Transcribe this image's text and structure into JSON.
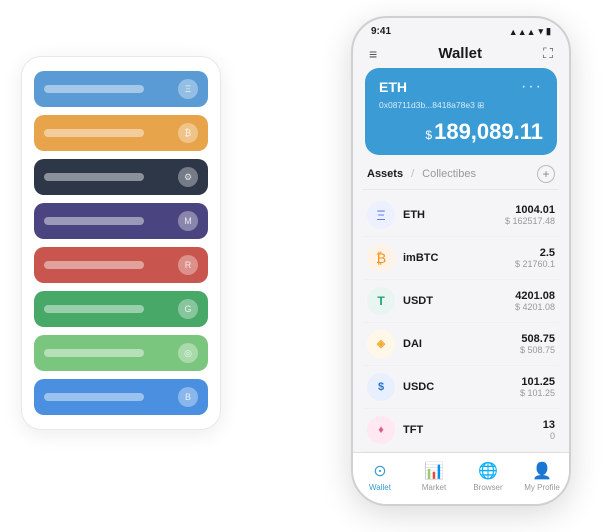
{
  "statusBar": {
    "time": "9:41",
    "signal": "●●●",
    "wifi": "▲",
    "battery": "■"
  },
  "header": {
    "menuIcon": "≡",
    "title": "Wallet",
    "expandIcon": "⛶"
  },
  "ethCard": {
    "title": "ETH",
    "dotsMenu": "···",
    "address": "0x08711d3b...8418a78e3 ⊞",
    "currencySymbol": "$",
    "amount": "189,089.11"
  },
  "assets": {
    "tabActive": "Assets",
    "separator": "/",
    "tabInactive": "Collectibes",
    "addIcon": "+"
  },
  "assetList": [
    {
      "id": "eth",
      "icon": "Ξ",
      "name": "ETH",
      "amount": "1004.01",
      "usd": "$ 162517.48",
      "iconClass": "icon-eth"
    },
    {
      "id": "imbtc",
      "icon": "₿",
      "name": "imBTC",
      "amount": "2.5",
      "usd": "$ 21760.1",
      "iconClass": "icon-btc"
    },
    {
      "id": "usdt",
      "icon": "T",
      "name": "USDT",
      "amount": "4201.08",
      "usd": "$ 4201.08",
      "iconClass": "icon-usdt"
    },
    {
      "id": "dai",
      "icon": "◈",
      "name": "DAI",
      "amount": "508.75",
      "usd": "$ 508.75",
      "iconClass": "icon-dai"
    },
    {
      "id": "usdc",
      "icon": "$",
      "name": "USDC",
      "amount": "101.25",
      "usd": "$ 101.25",
      "iconClass": "icon-usdc"
    },
    {
      "id": "tft",
      "icon": "♦",
      "name": "TFT",
      "amount": "13",
      "usd": "0",
      "iconClass": "icon-tft"
    }
  ],
  "bottomNav": [
    {
      "id": "wallet",
      "icon": "⊙",
      "label": "Wallet",
      "active": true
    },
    {
      "id": "market",
      "icon": "📈",
      "label": "Market",
      "active": false
    },
    {
      "id": "browser",
      "icon": "🌐",
      "label": "Browser",
      "active": false
    },
    {
      "id": "profile",
      "icon": "👤",
      "label": "My Profile",
      "active": false
    }
  ],
  "leftCards": [
    {
      "id": "c1",
      "colorClass": "card-blue"
    },
    {
      "id": "c2",
      "colorClass": "card-orange"
    },
    {
      "id": "c3",
      "colorClass": "card-dark"
    },
    {
      "id": "c4",
      "colorClass": "card-purple"
    },
    {
      "id": "c5",
      "colorClass": "card-red"
    },
    {
      "id": "c6",
      "colorClass": "card-green"
    },
    {
      "id": "c7",
      "colorClass": "card-light-green"
    },
    {
      "id": "c8",
      "colorClass": "card-blue2"
    }
  ]
}
